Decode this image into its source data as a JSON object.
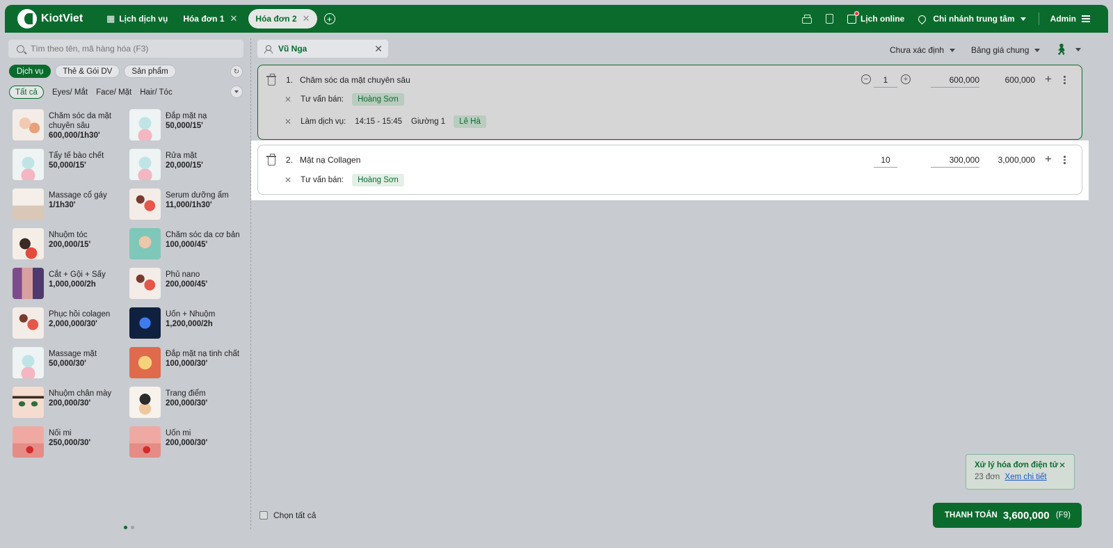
{
  "app": {
    "logo_text": "KiotViet"
  },
  "topbar": {
    "schedule_label": "Lịch dịch vụ",
    "tabs": [
      {
        "label": "Hóa đơn 1",
        "active": false
      },
      {
        "label": "Hóa đơn 2",
        "active": true
      }
    ],
    "online_schedule": "Lịch online",
    "branch": "Chi nhánh trung tâm",
    "user": "Admin"
  },
  "left": {
    "search_placeholder": "Tìm theo tên, mã hàng hóa (F3)",
    "categories": [
      "Dịch vụ",
      "Thẻ & Gói DV",
      "Sản phẩm"
    ],
    "subcategories": [
      "Tất cả",
      "Eyes/ Mắt",
      "Face/ Mặt",
      "Hair/ Tóc"
    ],
    "products": [
      {
        "name": "Chăm sóc da mặt chuyên sâu",
        "price": "600,000/1h30'",
        "icon": "facial-massage"
      },
      {
        "name": "Đắp mặt nạ",
        "price": "50,000/15'",
        "icon": "face-mask"
      },
      {
        "name": "Tẩy tế bào chết",
        "price": "50,000/15'",
        "icon": "face-mask"
      },
      {
        "name": "Rửa mặt",
        "price": "20,000/15'",
        "icon": "face-mask"
      },
      {
        "name": "Massage cổ gáy",
        "price": "1/1h30'",
        "icon": "neck-massage"
      },
      {
        "name": "Serum dưỡng ẩm",
        "price": "11,000/1h30'",
        "icon": "hair-salon"
      },
      {
        "name": "Nhuộm tóc",
        "price": "200,000/15'",
        "icon": "hair-dye"
      },
      {
        "name": "Chăm sóc da cơ bản",
        "price": "100,000/45'",
        "icon": "basic-skincare"
      },
      {
        "name": "Cắt + Gội + Sấy",
        "price": "1,000,000/2h",
        "icon": "salon"
      },
      {
        "name": "Phủ nano",
        "price": "200,000/45'",
        "icon": "hair-salon"
      },
      {
        "name": "Phục hồi colagen",
        "price": "2,000,000/30'",
        "icon": "hair-salon"
      },
      {
        "name": "Uốn + Nhuộm",
        "price": "1,200,000/2h",
        "icon": "blue-flower"
      },
      {
        "name": "Massage mặt",
        "price": "50,000/30'",
        "icon": "face-mask"
      },
      {
        "name": "Đắp mặt nạ tinh chất",
        "price": "100,000/30'",
        "icon": "essence-mask"
      },
      {
        "name": "Nhuộm chân mày",
        "price": "200,000/30'",
        "icon": "eyebrow"
      },
      {
        "name": "Trang điểm",
        "price": "200,000/30'",
        "icon": "makeup"
      },
      {
        "name": "Nối mi",
        "price": "250,000/30'",
        "icon": "eyelash"
      },
      {
        "name": "Uốn mi",
        "price": "200,000/30'",
        "icon": "eyelash"
      }
    ]
  },
  "order": {
    "customer": "Vũ Nga",
    "status_select": "Chưa xác định",
    "pricebook_select": "Bảng giá chung",
    "lines": [
      {
        "index": "1.",
        "name": "Chăm sóc da mặt chuyên sâu",
        "qty": "1",
        "price": "600,000",
        "total": "600,000",
        "consultant_label": "Tư vấn bán:",
        "consultant": "Hoàng Sơn",
        "service_label": "Làm dịch vụ:",
        "time": "14:15 - 15:45",
        "bed": "Giường 1",
        "staff": "Lê Hà"
      },
      {
        "index": "2.",
        "name": "Mặt nạ Collagen",
        "qty": "10",
        "price": "300,000",
        "total": "3,000,000",
        "consultant_label": "Tư vấn bán:",
        "consultant": "Hoàng Sơn"
      }
    ],
    "select_all": "Chọn tất cả"
  },
  "einvoice": {
    "title": "Xử lý hóa đơn điện tử",
    "count": "23 đơn",
    "link": "Xem chi tiết"
  },
  "payment": {
    "label": "THANH TOÁN",
    "amount": "3,600,000",
    "shortcut": "(F9)"
  }
}
